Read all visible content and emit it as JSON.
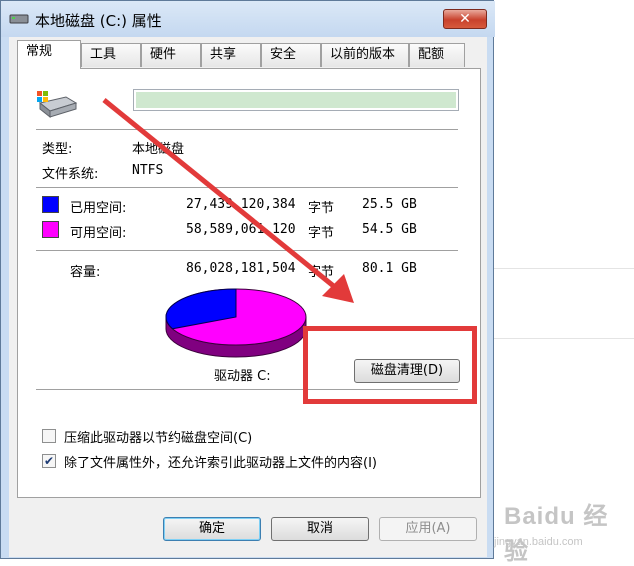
{
  "window": {
    "title": "本地磁盘 (C:) 属性",
    "close_label": "✕"
  },
  "tabs": [
    {
      "label": "常规",
      "active": true
    },
    {
      "label": "工具",
      "active": false
    },
    {
      "label": "硬件",
      "active": false
    },
    {
      "label": "共享",
      "active": false
    },
    {
      "label": "安全",
      "active": false
    },
    {
      "label": "以前的版本",
      "active": false
    },
    {
      "label": "配额",
      "active": false
    }
  ],
  "general": {
    "name_value": "",
    "type_label": "类型:",
    "type_value": "本地磁盘",
    "fs_label": "文件系统:",
    "fs_value": "NTFS",
    "used": {
      "label": "已用空间:",
      "bytes": "27,439,120,384",
      "unit": "字节",
      "size": "25.5 GB",
      "color": "#0000ff"
    },
    "free": {
      "label": "可用空间:",
      "bytes": "58,589,061,120",
      "unit": "字节",
      "size": "54.5 GB",
      "color": "#ff00ff"
    },
    "capacity": {
      "label": "容量:",
      "bytes": "86,028,181,504",
      "unit": "字节",
      "size": "80.1 GB"
    },
    "drive_label": "驱动器 C:",
    "cleanup_button": "磁盘清理(D)",
    "used_fraction": 0.319
  },
  "options": {
    "compress": {
      "label": "压缩此驱动器以节约磁盘空间(C)",
      "checked": false
    },
    "index": {
      "label": "除了文件属性外，还允许索引此驱动器上文件的内容(I)",
      "checked": true
    }
  },
  "buttons": {
    "ok": "确定",
    "cancel": "取消",
    "apply": "应用(A)"
  },
  "watermark": {
    "brand": "Baidu 经验",
    "url": "jingyan.baidu.com"
  },
  "colors": {
    "used": "#0000ff",
    "free": "#ff00ff",
    "annotation": "#e23a3a"
  }
}
